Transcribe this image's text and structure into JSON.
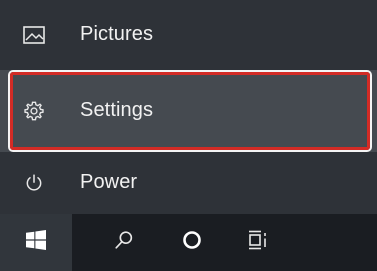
{
  "start_menu": {
    "items": [
      {
        "label": "Pictures",
        "icon": "pictures-icon"
      },
      {
        "label": "Settings",
        "icon": "gear-icon",
        "highlighted": true
      },
      {
        "label": "Power",
        "icon": "power-icon"
      }
    ],
    "highlight_color": "#d32b25"
  },
  "taskbar": {
    "buttons": [
      {
        "icon": "windows-logo-icon"
      },
      {
        "icon": "search-icon"
      },
      {
        "icon": "cortana-icon"
      },
      {
        "icon": "task-view-icon"
      }
    ]
  },
  "colors": {
    "menu_background": "#2e3238",
    "hover_background": "#454a50",
    "taskbar_background": "#1a1d22",
    "text": "#f2f2f2"
  }
}
